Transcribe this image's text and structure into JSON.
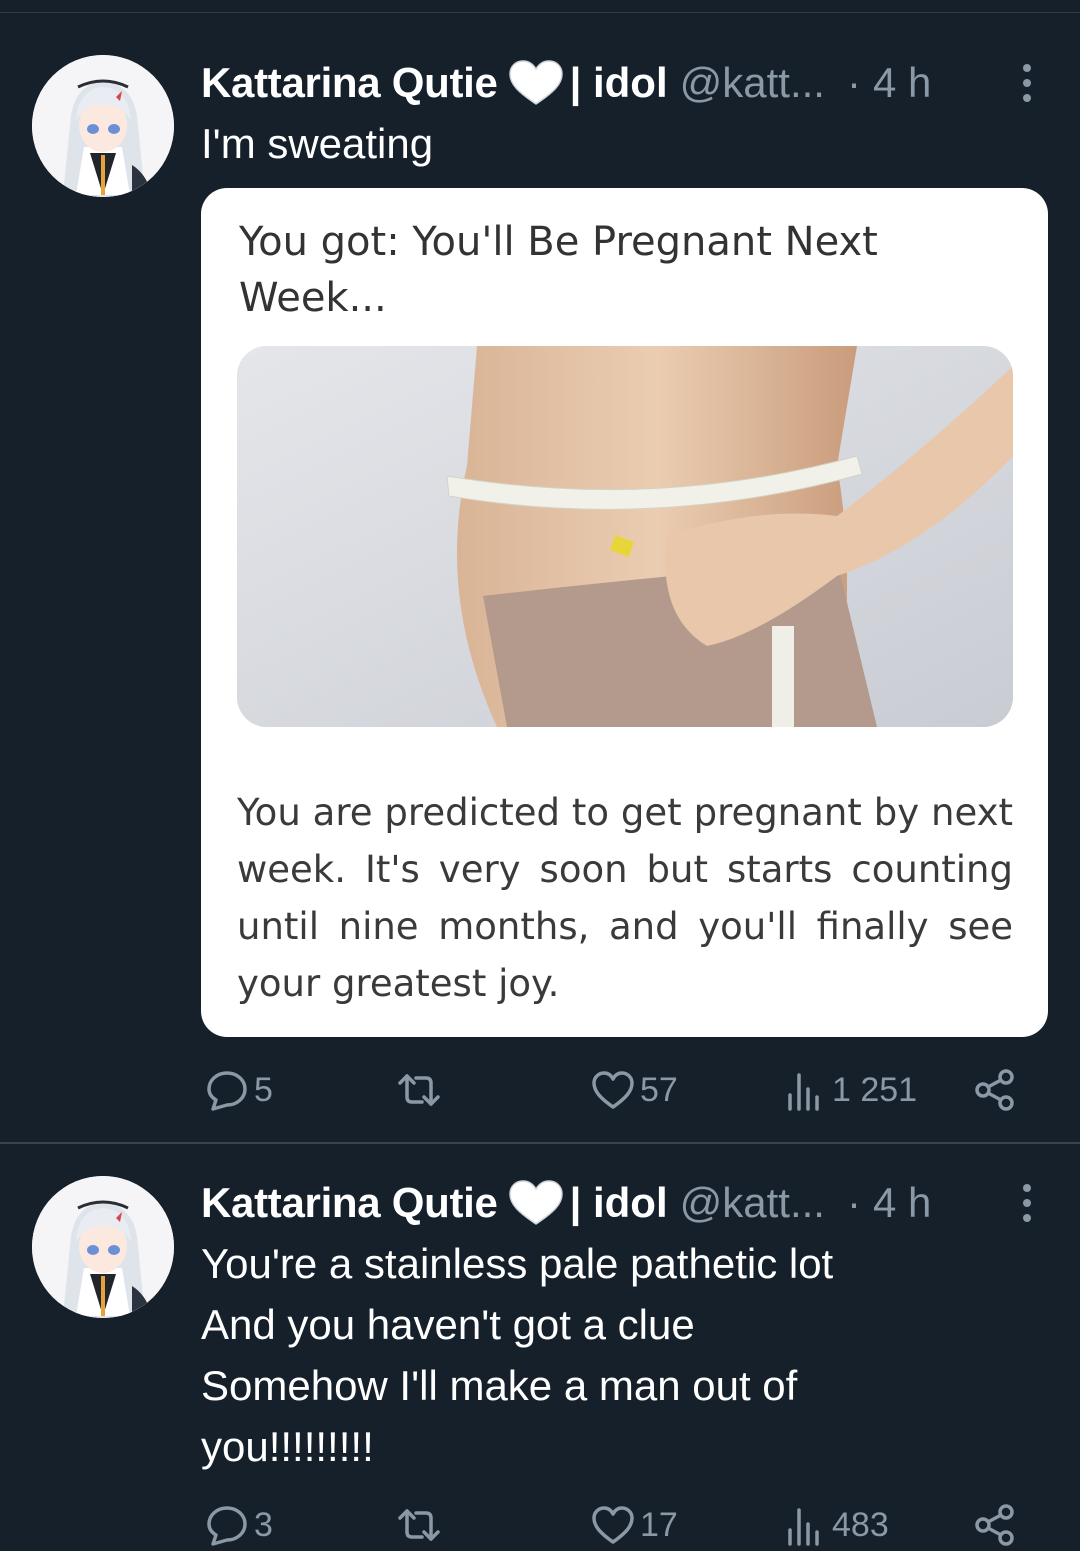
{
  "colors": {
    "background": "#15202b",
    "text_primary": "#ffffff",
    "text_secondary": "#8b98a5",
    "card_background": "#ffffff"
  },
  "tweets": [
    {
      "author": {
        "name": "Kattarina Qutie",
        "name_suffix": "| idol",
        "handle": "@katt...",
        "heart_icon": "white-heart-icon"
      },
      "separator": "·",
      "time": "4 h",
      "text": "I'm sweating",
      "quiz_card": {
        "title": "You got: You'll Be Pregnant Next Week...",
        "image": "belly-measuring-tape-photo",
        "body": "You are predicted to get pregnant by next week. It's very soon but starts counting until nine months, and you'll finally see your greatest joy."
      },
      "actions": {
        "replies": "5",
        "retweets": "",
        "likes": "57",
        "views": "1 251"
      }
    },
    {
      "author": {
        "name": "Kattarina Qutie",
        "name_suffix": "| idol",
        "handle": "@katt...",
        "heart_icon": "white-heart-icon"
      },
      "separator": "·",
      "time": "4 h",
      "text": "You're a stainless pale pathetic lot\nAnd you haven't got a clue\nSomehow I'll make a man out of\nyou!!!!!!!!!",
      "actions": {
        "replies": "3",
        "retweets": "",
        "likes": "17",
        "views": "483"
      }
    }
  ]
}
